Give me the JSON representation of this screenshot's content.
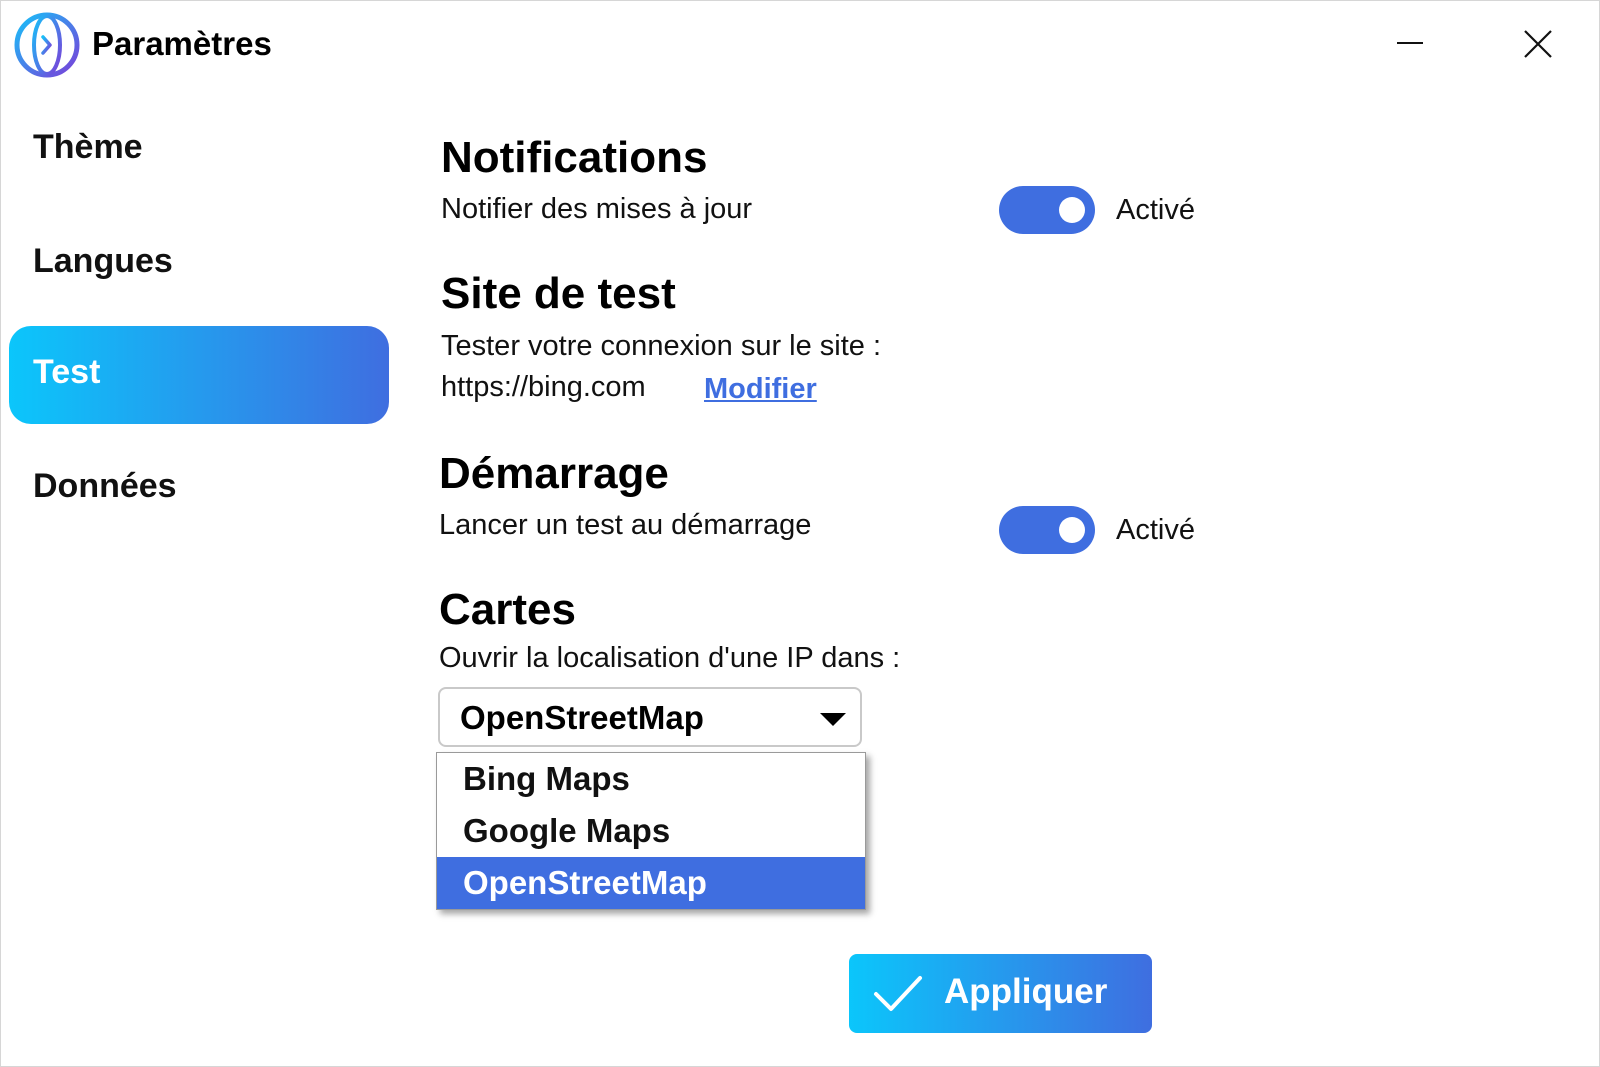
{
  "window": {
    "title": "Paramètres",
    "icons": {
      "logo": "app-logo-icon",
      "minimize": "minimize-icon",
      "close": "close-icon"
    }
  },
  "sidebar": {
    "items": [
      {
        "label": "Thème",
        "active": false
      },
      {
        "label": "Langues",
        "active": false
      },
      {
        "label": "Test",
        "active": true
      },
      {
        "label": "Données",
        "active": false
      }
    ]
  },
  "notifications": {
    "title": "Notifications",
    "description": "Notifier des mises à jour",
    "toggle_state": "Activé"
  },
  "test_site": {
    "title": "Site de test",
    "description": "Tester votre connexion sur le site :",
    "url": "https://bing.com",
    "modify_link": "Modifier"
  },
  "startup": {
    "title": "Démarrage",
    "description": "Lancer un test au démarrage",
    "toggle_state": "Activé"
  },
  "maps": {
    "title": "Cartes",
    "description": "Ouvrir la localisation d'une IP dans :",
    "selected": "OpenStreetMap",
    "options": [
      "Bing Maps",
      "Google Maps",
      "OpenStreetMap"
    ]
  },
  "apply_button": {
    "label": "Appliquer",
    "icon": "check-icon"
  },
  "colors": {
    "accent": "#3f6ee0",
    "gradient_start": "#0bc6fb",
    "gradient_end": "#3f6ee0"
  }
}
